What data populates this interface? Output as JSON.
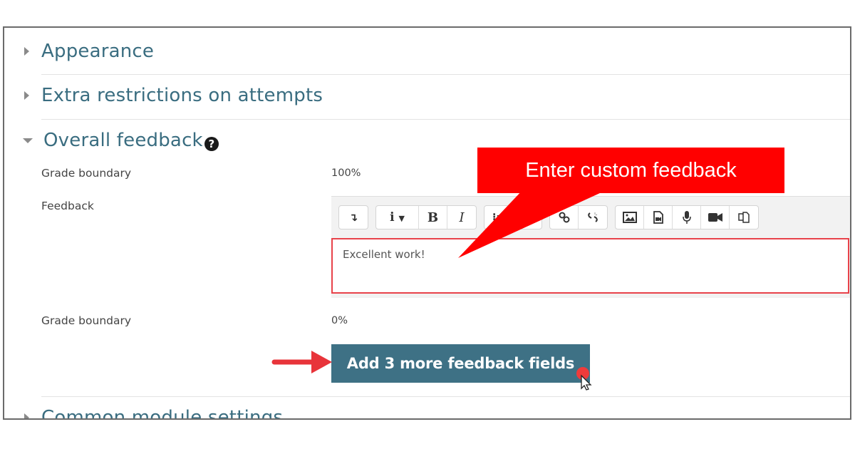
{
  "sections": {
    "appearance": {
      "title": "Appearance",
      "expanded": false
    },
    "extra_restrictions": {
      "title": "Extra restrictions on attempts",
      "expanded": false
    },
    "overall_feedback": {
      "title": "Overall feedback",
      "expanded": true,
      "help_icon": "question-circle-icon",
      "help_glyph": "?"
    },
    "common_module": {
      "title": "Common module settings",
      "expanded": false
    }
  },
  "overall_feedback": {
    "grade_boundary_label_1": "Grade boundary",
    "grade_boundary_value_1": "100%",
    "feedback_label": "Feedback",
    "feedback_text": "Excellent work!",
    "grade_boundary_label_2": "Grade boundary",
    "grade_boundary_value_2": "0%",
    "add_button_label": "Add 3 more feedback fields"
  },
  "toolbar": {
    "groups": [
      [
        {
          "name": "toggle-toolbar-icon",
          "glyph": "↴"
        }
      ],
      [
        {
          "name": "paragraph-styles-icon",
          "glyph": "i ▾"
        },
        {
          "name": "bold-icon",
          "glyph": "B"
        },
        {
          "name": "italic-icon",
          "glyph": "I"
        }
      ],
      [
        {
          "name": "unordered-list-icon",
          "glyph": "⁝≡"
        },
        {
          "name": "ordered-list-icon",
          "glyph": ""
        }
      ],
      [
        {
          "name": "link-icon",
          "glyph": "∞"
        },
        {
          "name": "unlink-icon",
          "glyph": "⚯"
        }
      ],
      [
        {
          "name": "image-icon",
          "glyph": "🖼"
        },
        {
          "name": "media-icon",
          "glyph": "▣"
        },
        {
          "name": "record-audio-icon",
          "glyph": "🎙"
        },
        {
          "name": "record-video-icon",
          "glyph": "■◀"
        },
        {
          "name": "manage-files-icon",
          "glyph": "⧉"
        }
      ]
    ]
  },
  "annotation": {
    "callout_text": "Enter custom feedback",
    "callout_color": "#ff0000",
    "arrow_color": "#e8343a"
  },
  "colors": {
    "section_title": "#3a6d80",
    "primary_button": "#3e7185",
    "invalid_border": "#e8424a"
  }
}
